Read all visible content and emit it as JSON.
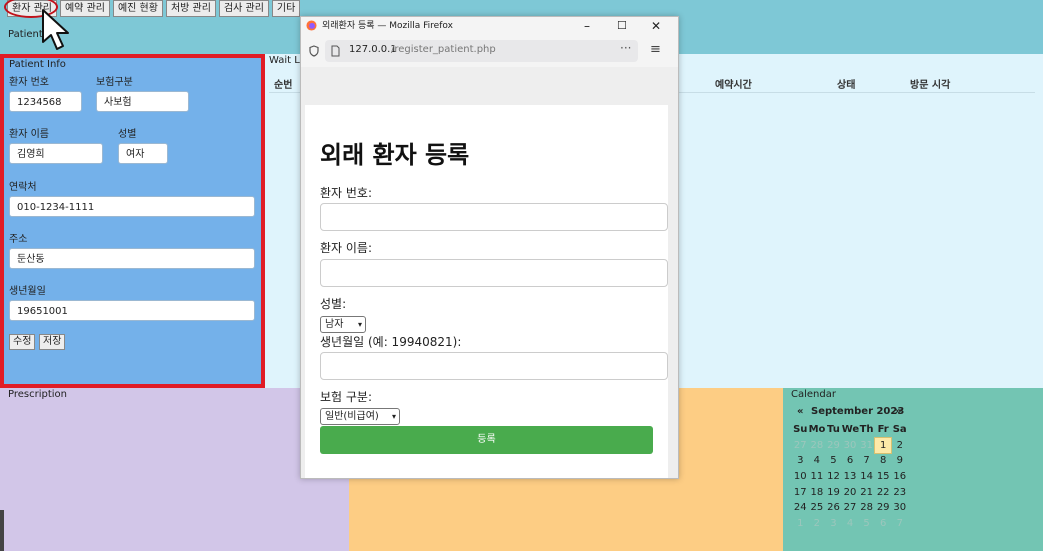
{
  "menu": {
    "items": [
      "환자 관리",
      "예약 관리",
      "예진 현황",
      "처방 관리",
      "검사 관리",
      "기타"
    ]
  },
  "patient_view_label": "Patient V",
  "patient_info": {
    "title": "Patient Info",
    "patient_no_label": "환자 번호",
    "patient_no": "1234568",
    "insurance_label": "보험구분",
    "insurance": "사보험",
    "name_label": "환자 이름",
    "name": "김영희",
    "gender_label": "성별",
    "gender": "여자",
    "phone_label": "연락처",
    "phone": "010-1234-1111",
    "address_label": "주소",
    "address": "둔산동",
    "birth_label": "생년월일",
    "birth": "19651001",
    "edit_label": "수정",
    "save_label": "저장"
  },
  "waitlist": {
    "title": "Wait Lis",
    "columns": [
      "순번",
      "예약시간",
      "상태",
      "방문 시각"
    ]
  },
  "prescription": {
    "title": "Prescription"
  },
  "calendar": {
    "title": "Calendar",
    "prev": "«",
    "next": "»",
    "month_label": "September 2023",
    "weekdays": [
      "Su",
      "Mo",
      "Tu",
      "We",
      "Th",
      "Fr",
      "Sa"
    ],
    "weeks": [
      [
        "27",
        "28",
        "29",
        "30",
        "31",
        "1",
        "2"
      ],
      [
        "3",
        "4",
        "5",
        "6",
        "7",
        "8",
        "9"
      ],
      [
        "10",
        "11",
        "12",
        "13",
        "14",
        "15",
        "16"
      ],
      [
        "17",
        "18",
        "19",
        "20",
        "21",
        "22",
        "23"
      ],
      [
        "24",
        "25",
        "26",
        "27",
        "28",
        "29",
        "30"
      ],
      [
        "1",
        "2",
        "3",
        "4",
        "5",
        "6",
        "7"
      ]
    ],
    "selected_day": "1"
  },
  "popup": {
    "window_title": "외래환자 등록 — Mozilla Firefox",
    "url_host": "127.0.0.1",
    "url_path": "/register_patient.php",
    "heading": "외래 환자 등록",
    "patient_no_label": "환자 번호:",
    "name_label": "환자 이름:",
    "gender_label": "성별:",
    "gender_value": "남자",
    "birth_label": "생년월일 (예: 19940821):",
    "insurance_label": "보험 구분:",
    "insurance_value": "일반(비급여)",
    "submit_label": "등록"
  }
}
